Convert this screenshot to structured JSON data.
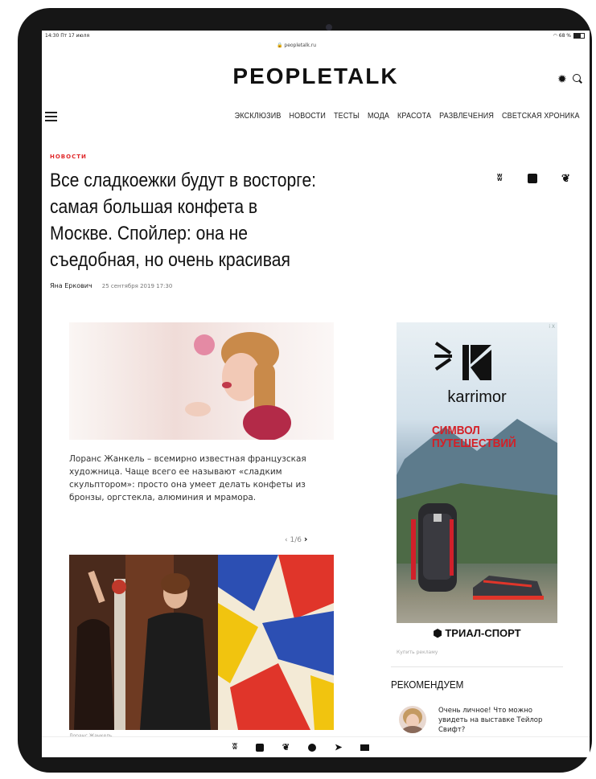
{
  "status_bar": {
    "time": "14:30 Пт 17 июля",
    "url": "peopletalk.ru",
    "battery": "68 %"
  },
  "header": {
    "logo": "PEOPLETALK"
  },
  "nav": {
    "items": [
      "ЭКСКЛЮЗИВ",
      "НОВОСТИ",
      "ТЕСТЫ",
      "МОДА",
      "КРАСОТА",
      "РАЗВЛЕЧЕНИЯ",
      "СВЕТСКАЯ ХРОНИКА"
    ]
  },
  "article": {
    "rubric": "НОВОСТИ",
    "title": "Все сладкоежки будут в восторге: самая большая конфета в Москве. Спойлер: она не съедобная, но очень красивая",
    "author": "Яна Еркович",
    "date": "25 сентября 2019 17:30",
    "caption": "Лоранс Жанкель – всемирно известная французская художница. Чаще всего ее называют «сладким скульптором»: просто она умеет делать конфеты из бронзы, оргстекла, алюминия и мрамора.",
    "pager": "1/6",
    "photo2_caption": "Лоранс Жанкель"
  },
  "share": {
    "vk": "vk",
    "facebook": "f",
    "twitter": "t"
  },
  "ad": {
    "mark": "i X",
    "brand": "karrimor",
    "slogan_1": "СИМВОЛ",
    "slogan_2": "ПУТЕШЕСТВИЙ",
    "footer": "ТРИАЛ-СПОРТ",
    "buy": "Купить рекламу"
  },
  "recommend": {
    "title": "РЕКОМЕНДУЕМ",
    "item_text": "Очень личное! Что можно увидеть на выставке Тейлор Свифт?"
  },
  "bottom_bar": {
    "icons": [
      "vk-icon",
      "facebook-icon",
      "twitter-icon",
      "whatsapp-icon",
      "telegram-icon",
      "mail-icon"
    ]
  }
}
